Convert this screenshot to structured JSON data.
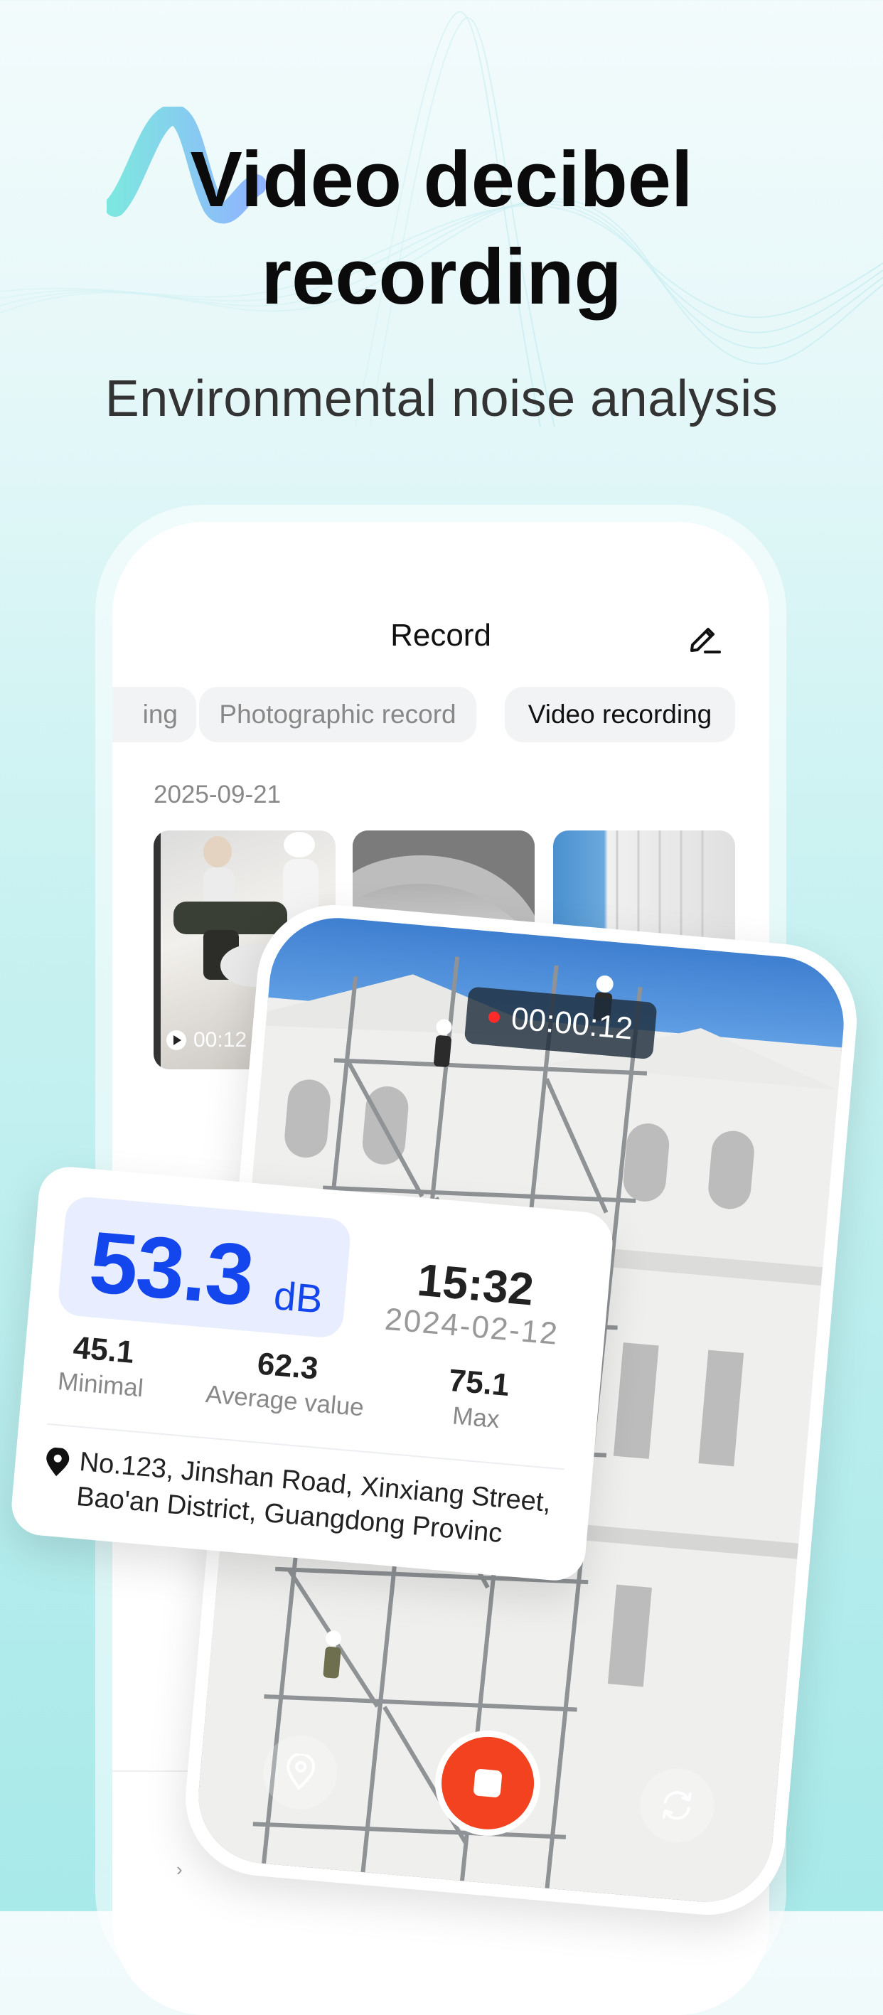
{
  "header": {
    "title_line1": "Video decibel",
    "title_line2": "recording",
    "subtitle": "Environmental noise analysis"
  },
  "app": {
    "screen_title": "Record",
    "tabs": [
      {
        "label": "ing",
        "active": false
      },
      {
        "label": "Photographic record",
        "active": false
      },
      {
        "label": "Video recording",
        "active": true
      }
    ],
    "date_group": "2025-09-21",
    "thumbnails": [
      {
        "duration": "00:12"
      }
    ]
  },
  "recorder": {
    "timer": "00:00:12",
    "status_color": "#ff2a2a",
    "stop_color": "#f2421f"
  },
  "measurement": {
    "decibel": "53.3",
    "unit": "dB",
    "time": "15:32",
    "date": "2024-02-12",
    "min_value": "45.1",
    "min_label": "Minimal",
    "avg_value": "62.3",
    "avg_label": "Average value",
    "max_value": "75.1",
    "max_label": "Max",
    "address": "No.123, Jinshan Road, Xinxiang Street, Bao'an District, Guangdong Provinc"
  },
  "colors": {
    "accent": "#1446ee",
    "accent_bg": "#e8eeff",
    "logo_gradient": [
      "#7ee6e0",
      "#8fb4ff"
    ]
  }
}
